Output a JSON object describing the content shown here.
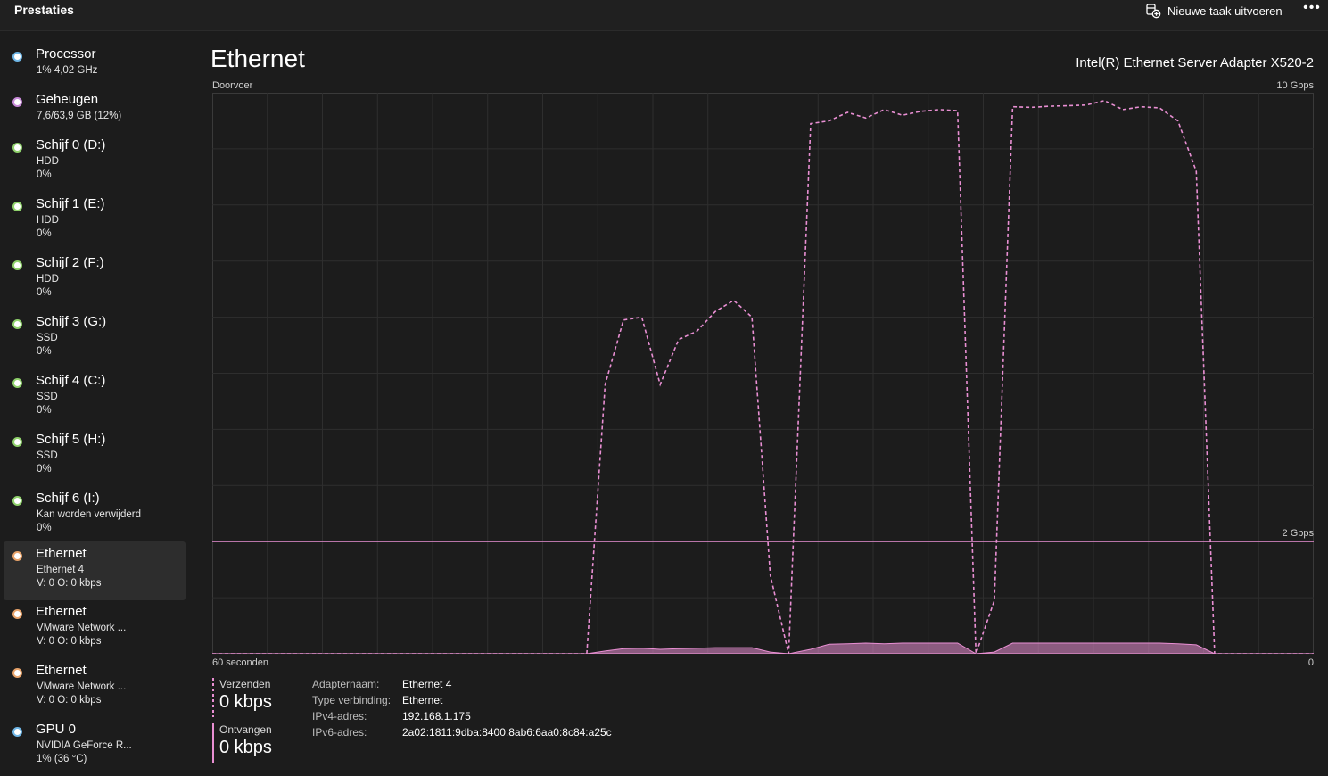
{
  "header": {
    "title": "Prestaties",
    "run_task_label": "Nieuwe taak uitvoeren",
    "run_task_icon": "new-task-icon",
    "more_label": "•••"
  },
  "sidebar": {
    "items": [
      {
        "name": "Processor",
        "line1": "1%  4,02 GHz",
        "line2": "",
        "dot_color": "#6fb6e6",
        "selected": false
      },
      {
        "name": "Geheugen",
        "line1": "7,6/63,9 GB (12%)",
        "line2": "",
        "dot_color": "#c78ad8",
        "selected": false
      },
      {
        "name": "Schijf 0 (D:)",
        "line1": "HDD",
        "line2": "0%",
        "dot_color": "#8fd16b",
        "selected": false
      },
      {
        "name": "Schijf 1 (E:)",
        "line1": "HDD",
        "line2": "0%",
        "dot_color": "#8fd16b",
        "selected": false
      },
      {
        "name": "Schijf 2 (F:)",
        "line1": "HDD",
        "line2": "0%",
        "dot_color": "#8fd16b",
        "selected": false
      },
      {
        "name": "Schijf 3 (G:)",
        "line1": "SSD",
        "line2": "0%",
        "dot_color": "#8fd16b",
        "selected": false
      },
      {
        "name": "Schijf 4 (C:)",
        "line1": "SSD",
        "line2": "0%",
        "dot_color": "#8fd16b",
        "selected": false
      },
      {
        "name": "Schijf 5 (H:)",
        "line1": "SSD",
        "line2": "0%",
        "dot_color": "#8fd16b",
        "selected": false
      },
      {
        "name": "Schijf 6 (I:)",
        "line1": "Kan worden verwijderd",
        "line2": "0%",
        "dot_color": "#8fd16b",
        "selected": false
      },
      {
        "name": "Ethernet",
        "line1": "Ethernet 4",
        "line2": "V: 0  O: 0 kbps",
        "dot_color": "#e8a36a",
        "selected": true
      },
      {
        "name": "Ethernet",
        "line1": "VMware Network ...",
        "line2": "V: 0  O: 0 kbps",
        "dot_color": "#e8a36a",
        "selected": false
      },
      {
        "name": "Ethernet",
        "line1": "VMware Network ...",
        "line2": "V: 0  O: 0 kbps",
        "dot_color": "#e8a36a",
        "selected": false
      },
      {
        "name": "GPU 0",
        "line1": "NVIDIA GeForce R...",
        "line2": "1%  (36 °C)",
        "dot_color": "#6fb6e6",
        "selected": false
      }
    ]
  },
  "main": {
    "title": "Ethernet",
    "adapter": "Intel(R) Ethernet Server Adapter X520-2",
    "throughput_label": "Doorvoer",
    "max_label": "10 Gbps",
    "time_label": "60 seconden",
    "zero_label": "0",
    "line_label": "2 Gbps"
  },
  "chart_data": {
    "type": "line",
    "xlabel": "60 seconden",
    "ylabel": "Doorvoer",
    "ylim": [
      0,
      10
    ],
    "y_unit": "Gbps",
    "x_range": [
      0,
      60
    ],
    "grid": true,
    "reference_line": 2,
    "reference_label": "2 Gbps",
    "series": [
      {
        "name": "Ontvangen",
        "style": "dashed",
        "color": "#e98fd3",
        "x": [
          0,
          20.4,
          21.4,
          22.4,
          23.4,
          24.4,
          25.4,
          26.4,
          27.4,
          28.4,
          29.4,
          30.4,
          31.4,
          32.6,
          33.6,
          34.6,
          35.6,
          36.6,
          37.6,
          38.6,
          39.6,
          40.6,
          41.6,
          42.6,
          43.6,
          44.6,
          45.6,
          46.6,
          47.6,
          48.6,
          49.6,
          50.6,
          51.6,
          52.6,
          53.6,
          54.6,
          55.6,
          60
        ],
        "y": [
          0,
          0,
          4.8,
          5.95,
          6.0,
          4.8,
          5.6,
          5.75,
          6.1,
          6.3,
          6.0,
          1.4,
          0.0,
          9.45,
          9.5,
          9.65,
          9.55,
          9.7,
          9.6,
          9.67,
          9.7,
          9.68,
          0.0,
          0.95,
          9.75,
          9.74,
          9.76,
          9.77,
          9.78,
          9.86,
          9.7,
          9.75,
          9.73,
          9.5,
          8.6,
          0.0,
          0.0,
          0.0
        ]
      },
      {
        "name": "Verzenden",
        "style": "solid-area",
        "color": "#e98fd3",
        "x": [
          0,
          20.4,
          21.4,
          22.4,
          23.4,
          24.4,
          25.4,
          26.4,
          27.4,
          28.4,
          29.4,
          30.4,
          31.4,
          32.6,
          33.6,
          34.6,
          35.6,
          36.6,
          37.6,
          38.6,
          39.6,
          40.6,
          41.6,
          42.6,
          43.6,
          44.6,
          45.6,
          46.6,
          47.6,
          48.6,
          49.6,
          50.6,
          51.6,
          52.6,
          53.6,
          54.6,
          55.6,
          60
        ],
        "y": [
          0,
          0,
          0.05,
          0.09,
          0.1,
          0.08,
          0.09,
          0.1,
          0.11,
          0.11,
          0.11,
          0.03,
          0.0,
          0.08,
          0.17,
          0.18,
          0.19,
          0.18,
          0.19,
          0.19,
          0.19,
          0.19,
          0.0,
          0.03,
          0.19,
          0.19,
          0.19,
          0.19,
          0.19,
          0.19,
          0.19,
          0.19,
          0.19,
          0.18,
          0.16,
          0.0,
          0.0,
          0.0
        ]
      }
    ]
  },
  "stats": {
    "send": {
      "label": "Verzenden",
      "value": "0 kbps"
    },
    "receive": {
      "label": "Ontvangen",
      "value": "0 kbps"
    }
  },
  "details": [
    {
      "key": "Adapternaam:",
      "value": "Ethernet 4"
    },
    {
      "key": "Type verbinding:",
      "value": "Ethernet"
    },
    {
      "key": "IPv4-adres:",
      "value": "192.168.1.175"
    },
    {
      "key": "IPv6-adres:",
      "value": "2a02:1811:9dba:8400:8ab6:6aa0:8c84:a25c"
    }
  ]
}
